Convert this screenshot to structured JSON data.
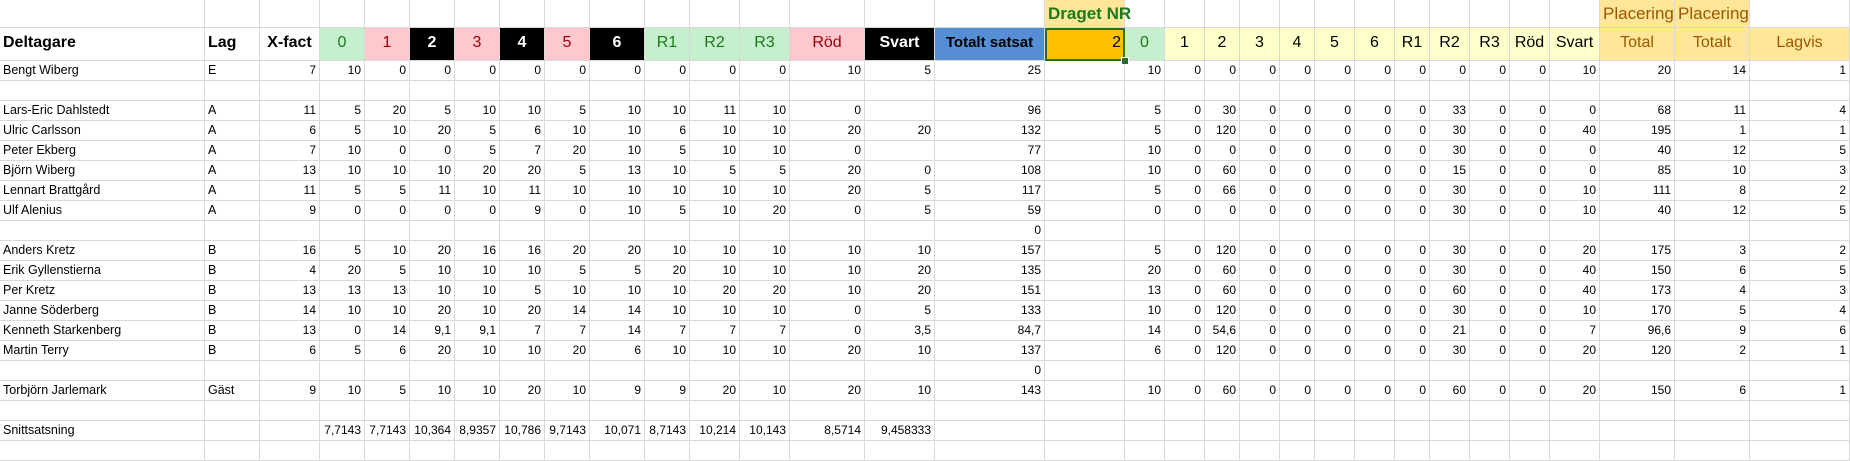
{
  "sheet": {
    "top_headers": {
      "dragetNr": "Draget NR",
      "placering1": "Placering",
      "placering2": "Placering"
    },
    "colors": {
      "green": "#c6efce",
      "pink": "#ffc7ce",
      "black": "#000000",
      "blue": "#558ed5",
      "orange": "#ffc000",
      "lightYellow": "#ffffcc",
      "gold": "#ffe699",
      "greenText": "#1a7a1a",
      "pinkText": "#9c0006",
      "goldText": "#9c5700",
      "dragetText": "#1a7a1a"
    },
    "headers": [
      {
        "text": "Deltagare",
        "bg": "",
        "fg": "#000000",
        "bold": true,
        "align": "txt"
      },
      {
        "text": "Lag",
        "bg": "",
        "fg": "#000000",
        "bold": true,
        "align": "txt"
      },
      {
        "text": "X-fact",
        "bg": "",
        "fg": "#000000",
        "bold": true,
        "align": "ctr"
      },
      {
        "text": "0",
        "bg": "#c6efce",
        "fg": "#1a7a1a",
        "bold": false,
        "align": "ctr"
      },
      {
        "text": "1",
        "bg": "#ffc7ce",
        "fg": "#9c0006",
        "bold": false,
        "align": "ctr"
      },
      {
        "text": "2",
        "bg": "#000000",
        "fg": "#ffffff",
        "bold": true,
        "align": "ctr"
      },
      {
        "text": "3",
        "bg": "#ffc7ce",
        "fg": "#9c0006",
        "bold": false,
        "align": "ctr"
      },
      {
        "text": "4",
        "bg": "#000000",
        "fg": "#ffffff",
        "bold": true,
        "align": "ctr"
      },
      {
        "text": "5",
        "bg": "#ffc7ce",
        "fg": "#9c0006",
        "bold": false,
        "align": "ctr"
      },
      {
        "text": "6",
        "bg": "#000000",
        "fg": "#ffffff",
        "bold": true,
        "align": "ctr"
      },
      {
        "text": "R1",
        "bg": "#c6efce",
        "fg": "#1a7a1a",
        "bold": false,
        "align": "ctr"
      },
      {
        "text": "R2",
        "bg": "#c6efce",
        "fg": "#1a7a1a",
        "bold": false,
        "align": "ctr"
      },
      {
        "text": "R3",
        "bg": "#c6efce",
        "fg": "#1a7a1a",
        "bold": false,
        "align": "ctr"
      },
      {
        "text": "Röd",
        "bg": "#ffc7ce",
        "fg": "#9c0006",
        "bold": false,
        "align": "ctr"
      },
      {
        "text": "Svart",
        "bg": "#000000",
        "fg": "#ffffff",
        "bold": true,
        "align": "ctr"
      },
      {
        "text": "Totalt satsat",
        "bg": "#558ed5",
        "fg": "#000000",
        "bold": true,
        "align": "ctr"
      },
      {
        "text": "2",
        "bg": "#ffc000",
        "fg": "#000000",
        "bold": false,
        "align": "num"
      },
      {
        "text": "0",
        "bg": "#c6efce",
        "fg": "#1a7a1a",
        "bold": false,
        "align": "ctr"
      },
      {
        "text": "1",
        "bg": "#ffffcc",
        "fg": "#000000",
        "bold": false,
        "align": "ctr"
      },
      {
        "text": "2",
        "bg": "#ffffcc",
        "fg": "#000000",
        "bold": false,
        "align": "ctr"
      },
      {
        "text": "3",
        "bg": "#ffffcc",
        "fg": "#000000",
        "bold": false,
        "align": "ctr"
      },
      {
        "text": "4",
        "bg": "#ffffcc",
        "fg": "#000000",
        "bold": false,
        "align": "ctr"
      },
      {
        "text": "5",
        "bg": "#ffffcc",
        "fg": "#000000",
        "bold": false,
        "align": "ctr"
      },
      {
        "text": "6",
        "bg": "#ffffcc",
        "fg": "#000000",
        "bold": false,
        "align": "ctr"
      },
      {
        "text": "R1",
        "bg": "#ffffcc",
        "fg": "#000000",
        "bold": false,
        "align": "ctr"
      },
      {
        "text": "R2",
        "bg": "#ffffcc",
        "fg": "#000000",
        "bold": false,
        "align": "ctr"
      },
      {
        "text": "R3",
        "bg": "#ffffcc",
        "fg": "#000000",
        "bold": false,
        "align": "ctr"
      },
      {
        "text": "Röd",
        "bg": "#ffffcc",
        "fg": "#000000",
        "bold": false,
        "align": "ctr"
      },
      {
        "text": "Svart",
        "bg": "#ffffcc",
        "fg": "#000000",
        "bold": false,
        "align": "ctr"
      },
      {
        "text": "Total",
        "bg": "#ffe699",
        "fg": "#9c5700",
        "bold": false,
        "align": "ctr"
      },
      {
        "text": "Totalt",
        "bg": "#ffe699",
        "fg": "#9c5700",
        "bold": false,
        "align": "ctr"
      },
      {
        "text": "Lagvis",
        "bg": "#ffe699",
        "fg": "#9c5700",
        "bold": false,
        "align": "ctr"
      }
    ],
    "rows": [
      [
        "Bengt Wiberg",
        "E",
        "7",
        "10",
        "0",
        "0",
        "0",
        "0",
        "0",
        "0",
        "0",
        "0",
        "0",
        "10",
        "5",
        "25",
        "",
        "10",
        "0",
        "0",
        "0",
        "0",
        "0",
        "0",
        "0",
        "0",
        "0",
        "0",
        "10",
        "20",
        "14",
        "1"
      ],
      [
        "",
        "",
        "",
        "",
        "",
        "",
        "",
        "",
        "",
        "",
        "",
        "",
        "",
        "",
        "",
        "",
        "",
        "",
        "",
        "",
        "",
        "",
        "",
        "",
        "",
        "",
        "",
        "",
        "",
        "",
        "",
        ""
      ],
      [
        "Lars-Eric Dahlstedt",
        "A",
        "11",
        "5",
        "20",
        "5",
        "10",
        "10",
        "5",
        "10",
        "10",
        "11",
        "10",
        "0",
        "",
        "96",
        "",
        "5",
        "0",
        "30",
        "0",
        "0",
        "0",
        "0",
        "0",
        "33",
        "0",
        "0",
        "0",
        "68",
        "11",
        "4"
      ],
      [
        "Ulric Carlsson",
        "A",
        "6",
        "5",
        "10",
        "20",
        "5",
        "6",
        "10",
        "10",
        "6",
        "10",
        "10",
        "20",
        "20",
        "132",
        "",
        "5",
        "0",
        "120",
        "0",
        "0",
        "0",
        "0",
        "0",
        "30",
        "0",
        "0",
        "40",
        "195",
        "1",
        "1"
      ],
      [
        "Peter Ekberg",
        "A",
        "7",
        "10",
        "0",
        "0",
        "5",
        "7",
        "20",
        "10",
        "5",
        "10",
        "10",
        "0",
        "",
        "77",
        "",
        "10",
        "0",
        "0",
        "0",
        "0",
        "0",
        "0",
        "0",
        "30",
        "0",
        "0",
        "0",
        "40",
        "12",
        "5"
      ],
      [
        "Björn Wiberg",
        "A",
        "13",
        "10",
        "10",
        "10",
        "20",
        "20",
        "5",
        "13",
        "10",
        "5",
        "5",
        "20",
        "0",
        "108",
        "",
        "10",
        "0",
        "60",
        "0",
        "0",
        "0",
        "0",
        "0",
        "15",
        "0",
        "0",
        "0",
        "85",
        "10",
        "3"
      ],
      [
        "Lennart Brattgård",
        "A",
        "11",
        "5",
        "5",
        "11",
        "10",
        "11",
        "10",
        "10",
        "10",
        "10",
        "10",
        "20",
        "5",
        "117",
        "",
        "5",
        "0",
        "66",
        "0",
        "0",
        "0",
        "0",
        "0",
        "30",
        "0",
        "0",
        "10",
        "111",
        "8",
        "2"
      ],
      [
        "Ulf Alenius",
        "A",
        "9",
        "0",
        "0",
        "0",
        "0",
        "9",
        "0",
        "10",
        "5",
        "10",
        "20",
        "0",
        "5",
        "59",
        "",
        "0",
        "0",
        "0",
        "0",
        "0",
        "0",
        "0",
        "0",
        "30",
        "0",
        "0",
        "10",
        "40",
        "12",
        "5"
      ],
      [
        "",
        "",
        "",
        "",
        "",
        "",
        "",
        "",
        "",
        "",
        "",
        "",
        "",
        "",
        "",
        "0",
        "",
        "",
        "",
        "",
        "",
        "",
        "",
        "",
        "",
        "",
        "",
        "",
        "",
        "",
        "",
        ""
      ],
      [
        "Anders Kretz",
        "B",
        "16",
        "5",
        "10",
        "20",
        "16",
        "16",
        "20",
        "20",
        "10",
        "10",
        "10",
        "10",
        "10",
        "157",
        "",
        "5",
        "0",
        "120",
        "0",
        "0",
        "0",
        "0",
        "0",
        "30",
        "0",
        "0",
        "20",
        "175",
        "3",
        "2"
      ],
      [
        "Erik Gyllenstierna",
        "B",
        "4",
        "20",
        "5",
        "10",
        "10",
        "10",
        "5",
        "5",
        "20",
        "10",
        "10",
        "10",
        "20",
        "135",
        "",
        "20",
        "0",
        "60",
        "0",
        "0",
        "0",
        "0",
        "0",
        "30",
        "0",
        "0",
        "40",
        "150",
        "6",
        "5"
      ],
      [
        "Per Kretz",
        "B",
        "13",
        "13",
        "13",
        "10",
        "10",
        "5",
        "10",
        "10",
        "10",
        "20",
        "20",
        "10",
        "20",
        "151",
        "",
        "13",
        "0",
        "60",
        "0",
        "0",
        "0",
        "0",
        "0",
        "60",
        "0",
        "0",
        "40",
        "173",
        "4",
        "3"
      ],
      [
        "Janne Söderberg",
        "B",
        "14",
        "10",
        "10",
        "20",
        "10",
        "20",
        "14",
        "14",
        "10",
        "10",
        "10",
        "0",
        "5",
        "133",
        "",
        "10",
        "0",
        "120",
        "0",
        "0",
        "0",
        "0",
        "0",
        "30",
        "0",
        "0",
        "10",
        "170",
        "5",
        "4"
      ],
      [
        "Kenneth Starkenberg",
        "B",
        "13",
        "0",
        "14",
        "9,1",
        "9,1",
        "7",
        "7",
        "14",
        "7",
        "7",
        "7",
        "0",
        "3,5",
        "84,7",
        "",
        "14",
        "0",
        "54,6",
        "0",
        "0",
        "0",
        "0",
        "0",
        "21",
        "0",
        "0",
        "7",
        "96,6",
        "9",
        "6"
      ],
      [
        "Martin Terry",
        "B",
        "6",
        "5",
        "6",
        "20",
        "10",
        "10",
        "20",
        "6",
        "10",
        "10",
        "10",
        "20",
        "10",
        "137",
        "",
        "6",
        "0",
        "120",
        "0",
        "0",
        "0",
        "0",
        "0",
        "30",
        "0",
        "0",
        "20",
        "120",
        "2",
        "1"
      ],
      [
        "",
        "",
        "",
        "",
        "",
        "",
        "",
        "",
        "",
        "",
        "",
        "",
        "",
        "",
        "",
        "0",
        "",
        "",
        "",
        "",
        "",
        "",
        "",
        "",
        "",
        "",
        "",
        "",
        "",
        "",
        "",
        ""
      ],
      [
        "Torbjörn Jarlemark",
        "Gäst",
        "9",
        "10",
        "5",
        "10",
        "10",
        "20",
        "10",
        "9",
        "9",
        "20",
        "10",
        "20",
        "10",
        "143",
        "",
        "10",
        "0",
        "60",
        "0",
        "0",
        "0",
        "0",
        "0",
        "60",
        "0",
        "0",
        "20",
        "150",
        "6",
        "1"
      ],
      [
        "",
        "",
        "",
        "",
        "",
        "",
        "",
        "",
        "",
        "",
        "",
        "",
        "",
        "",
        "",
        "",
        "",
        "",
        "",
        "",
        "",
        "",
        "",
        "",
        "",
        "",
        "",
        "",
        "",
        "",
        "",
        ""
      ],
      [
        "Snittsatsning",
        "",
        "",
        "7,7143",
        "7,7143",
        "10,364",
        "8,9357",
        "10,786",
        "9,7143",
        "10,071",
        "8,7143",
        "10,214",
        "10,143",
        "8,5714",
        "9,458333",
        "",
        "",
        "",
        "",
        "",
        "",
        "",
        "",
        "",
        "",
        "",
        "",
        "",
        "",
        "",
        "",
        ""
      ],
      [
        "",
        "",
        "",
        "",
        "",
        "",
        "",
        "",
        "",
        "",
        "",
        "",
        "",
        "",
        "",
        "",
        "",
        "",
        "",
        "",
        "",
        "",
        "",
        "",
        "",
        "",
        "",
        "",
        "",
        "",
        "",
        ""
      ]
    ]
  }
}
